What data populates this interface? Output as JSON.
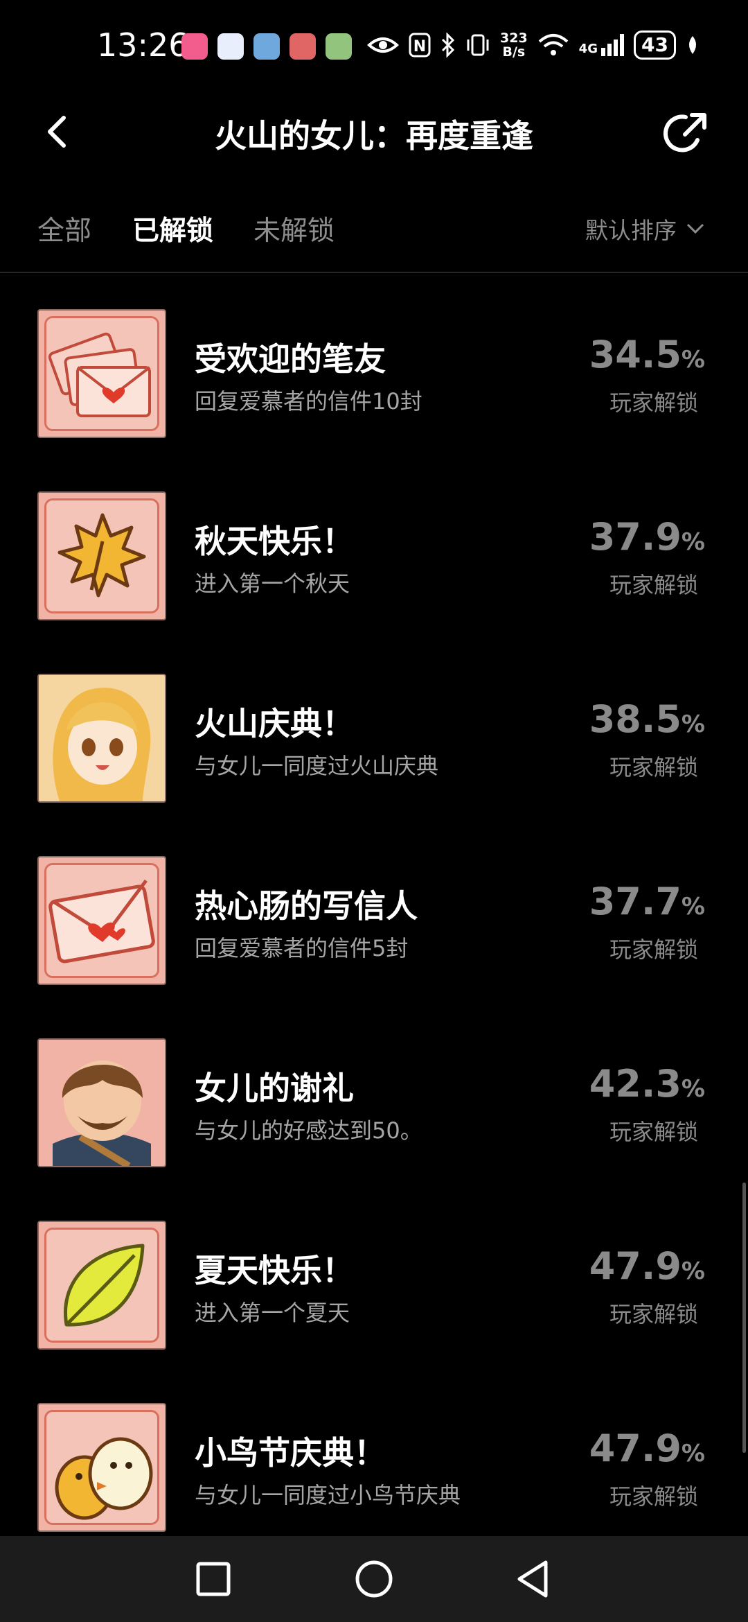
{
  "status_bar": {
    "time": "13:26",
    "net_speed_value": "323",
    "net_speed_unit": "B/s",
    "signal": "4G",
    "battery": "43"
  },
  "header": {
    "title": "火山的女儿：再度重逢"
  },
  "tabs": [
    {
      "label": "全部",
      "active": false
    },
    {
      "label": "已解锁",
      "active": true
    },
    {
      "label": "未解锁",
      "active": false
    }
  ],
  "sort": {
    "label": "默认排序"
  },
  "achievements": [
    {
      "title": "受欢迎的笔友",
      "desc": "回复爱慕者的信件10封",
      "pct": "34.5",
      "icon": "love-letters-icon"
    },
    {
      "title": "秋天快乐！",
      "desc": "进入第一个秋天",
      "pct": "37.9",
      "icon": "maple-leaf-icon"
    },
    {
      "title": "火山庆典！",
      "desc": "与女儿一同度过火山庆典",
      "pct": "38.5",
      "icon": "daughter-portrait-icon"
    },
    {
      "title": "热心肠的写信人",
      "desc": "回复爱慕者的信件5封",
      "pct": "37.7",
      "icon": "love-letter-icon"
    },
    {
      "title": "女儿的谢礼",
      "desc": "与女儿的好感达到50。",
      "pct": "42.3",
      "icon": "father-portrait-icon"
    },
    {
      "title": "夏天快乐！",
      "desc": "进入第一个夏天",
      "pct": "47.9",
      "icon": "green-leaf-icon"
    },
    {
      "title": "小鸟节庆典！",
      "desc": "与女儿一同度过小鸟节庆典",
      "pct": "47.9",
      "icon": "birds-icon"
    }
  ],
  "pct_unit": "%",
  "unlock_label": "玩家解锁",
  "colors": {
    "background": "#000000",
    "icon_bg": "#f1b3a5",
    "muted_text": "#8a8a8a"
  }
}
